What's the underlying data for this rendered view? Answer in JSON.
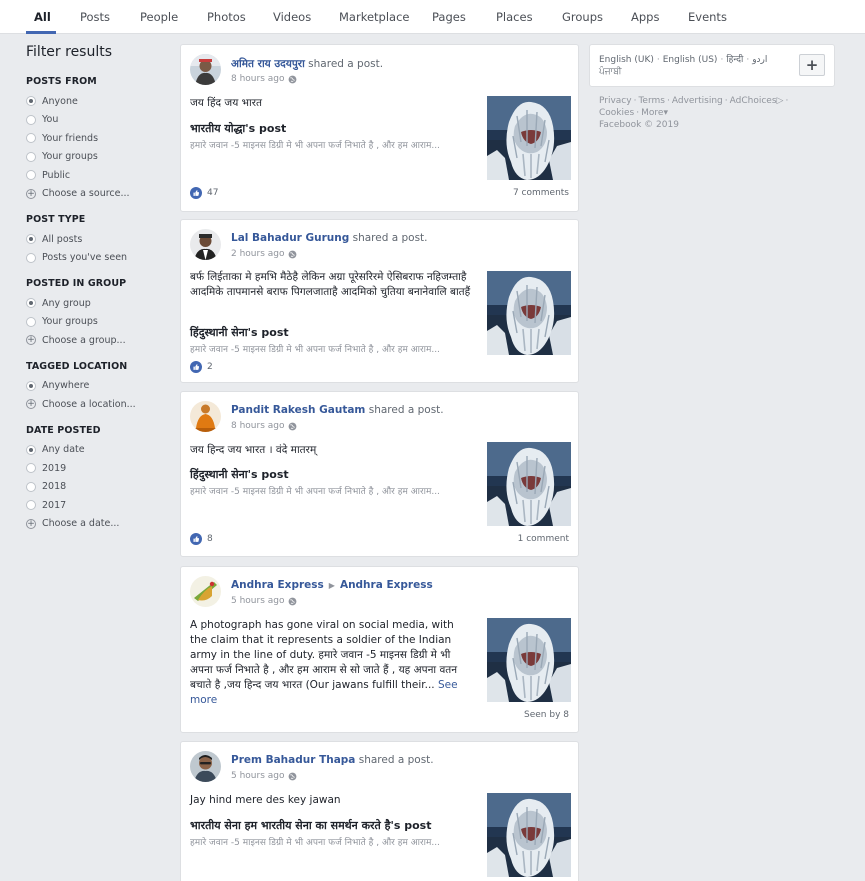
{
  "nav": {
    "tabs": [
      "All",
      "Posts",
      "People",
      "Photos",
      "Videos",
      "Marketplace",
      "Pages",
      "Places",
      "Groups",
      "Apps",
      "Events"
    ],
    "active": "All"
  },
  "filters": {
    "title": "Filter results",
    "sections": [
      {
        "heading": "POSTS FROM",
        "options": [
          {
            "label": "Anyone",
            "kind": "radio",
            "selected": true
          },
          {
            "label": "You",
            "kind": "radio",
            "selected": false
          },
          {
            "label": "Your friends",
            "kind": "radio",
            "selected": false
          },
          {
            "label": "Your groups",
            "kind": "radio",
            "selected": false
          },
          {
            "label": "Public",
            "kind": "radio",
            "selected": false
          },
          {
            "label": "Choose a source...",
            "kind": "add"
          }
        ]
      },
      {
        "heading": "POST TYPE",
        "options": [
          {
            "label": "All posts",
            "kind": "radio",
            "selected": true
          },
          {
            "label": "Posts you've seen",
            "kind": "radio",
            "selected": false
          }
        ]
      },
      {
        "heading": "POSTED IN GROUP",
        "options": [
          {
            "label": "Any group",
            "kind": "radio",
            "selected": true
          },
          {
            "label": "Your groups",
            "kind": "radio",
            "selected": false
          },
          {
            "label": "Choose a group...",
            "kind": "add"
          }
        ]
      },
      {
        "heading": "TAGGED LOCATION",
        "options": [
          {
            "label": "Anywhere",
            "kind": "radio",
            "selected": true
          },
          {
            "label": "Choose a location...",
            "kind": "add"
          }
        ]
      },
      {
        "heading": "DATE POSTED",
        "options": [
          {
            "label": "Any date",
            "kind": "radio",
            "selected": true
          },
          {
            "label": "2019",
            "kind": "radio",
            "selected": false
          },
          {
            "label": "2018",
            "kind": "radio",
            "selected": false
          },
          {
            "label": "2017",
            "kind": "radio",
            "selected": false
          },
          {
            "label": "Choose a date...",
            "kind": "add"
          }
        ]
      }
    ]
  },
  "posts": [
    {
      "author": "अमित राय उदयपुरा",
      "action": "shared a post.",
      "time": "8 hours ago",
      "text": "जय हिंद जय भारत",
      "link_title": "भारतीय योद्धा's post",
      "link_desc": "हमारे जवान -5 माइनस डिग्री मे भी अपना फर्ज निभाते है , और हम आराम...",
      "likes": "47",
      "footer_right": "7 comments"
    },
    {
      "author": "Lal Bahadur Gurung",
      "action": "shared a post.",
      "time": "2 hours ago",
      "text": "बर्फ लिईताका मे हमभि मैठेहै लेकिन अग्रा पूरेसरिरमे ऐसिबराफ नहिजम्ताहै आदमिके तापमानसे बराफ पिगलजाताहै आदमिको चुतिया बनानेवालि बातहैं",
      "link_title": "हिंदुस्थानी सेना's post",
      "link_desc": "हमारे जवान -5 माइनस डिग्री मे भी अपना फर्ज निभाते है , और हम आराम...",
      "likes": "2",
      "footer_right": ""
    },
    {
      "author": "Pandit Rakesh Gautam",
      "action": "shared a post.",
      "time": "8 hours ago",
      "text": "जय हिन्द जय भारत । वंदे मातरम्",
      "link_title": "हिंदुस्थानी सेना's post",
      "link_desc": "हमारे जवान -5 माइनस डिग्री मे भी अपना फर्ज निभाते है , और हम आराम...",
      "likes": "8",
      "footer_right": "1 comment"
    },
    {
      "author": "Andhra Express",
      "target": "Andhra Express",
      "time": "5 hours ago",
      "text": "A photograph has gone viral on social media, with the claim that it represents a soldier of the Indian army in the line of duty. हमारे जवान -5 माइनस डिग्री मे भी अपना फर्ज निभाते है , और हम आराम से सो जाते हैं , यह अपना वतन बचाते है ,जय हिन्द जय भारत (Our jawans fulfill their...",
      "see_more": "See more",
      "footer_right": "Seen by 8"
    },
    {
      "author": "Prem Bahadur Thapa",
      "action": "shared a post.",
      "time": "5 hours ago",
      "text": "Jay hind mere des key jawan",
      "link_title": "भारतीय सेना हम भारतीय सेना का समर्थन करते है's post",
      "link_desc": "हमारे जवान -5 माइनस डिग्री मे भी अपना फर्ज निभाते है , और हम आराम..."
    }
  ],
  "languages": [
    "English (UK)",
    "English (US)",
    "हिन्दी",
    "اردو",
    "ਪੰਜਾਬੀ"
  ],
  "add_language": "+",
  "footer": {
    "links": [
      "Privacy",
      "Terms",
      "Advertising",
      "AdChoices",
      "Cookies",
      "More"
    ],
    "copyright": "Facebook © 2019"
  }
}
